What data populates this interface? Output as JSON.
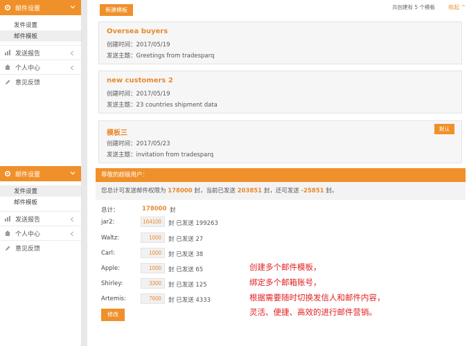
{
  "sidebar_top": {
    "header": "邮件设置",
    "sub_items": [
      "发件设置",
      "邮件模板"
    ],
    "active_index": 1,
    "items": [
      {
        "label": "发送报告",
        "icon": "chart-icon"
      },
      {
        "label": "个人中心",
        "icon": "home-icon"
      },
      {
        "label": "意见反馈",
        "icon": "pencil-icon"
      }
    ]
  },
  "sidebar_bottom": {
    "header": "邮件设置",
    "sub_items": [
      "发件设置",
      "邮件模板"
    ],
    "active_index": 0,
    "items": [
      {
        "label": "发送报告",
        "icon": "chart-icon"
      },
      {
        "label": "个人中心",
        "icon": "home-icon"
      },
      {
        "label": "意见反馈",
        "icon": "pencil-icon"
      }
    ]
  },
  "toolbar": {
    "new_template": "新建模板",
    "count_text": "共创建有 5 个模板",
    "collapse": "收起 ^"
  },
  "templates": [
    {
      "name": "Oversea buyers",
      "created": "创建时间：2017/05/19",
      "subject": "发送主题：Greetings from tradesparq",
      "default_btn": ""
    },
    {
      "name": "new customers 2",
      "created": "创建时间：2017/05/19",
      "subject": "发送主题：23 countries shipment data",
      "default_btn": ""
    },
    {
      "name": "模板三",
      "created": "创建时间：2017/05/23",
      "subject": "发送主题：invitation from tradesparq",
      "default_btn": "默认"
    }
  ],
  "quota": {
    "panel_title": "尊敬的超级用户：",
    "summary_prefix": "您总计可发送邮件权限为",
    "limit": "178000",
    "summary_mid1": "封，当前已发送",
    "sent": "203851",
    "summary_mid2": "封，还可发送",
    "remaining": "-25851",
    "summary_suffix": "封。",
    "total_label": "总计：",
    "total_value": "178000",
    "unit": "封",
    "accounts": [
      {
        "name": "jar2:",
        "quota": "164100",
        "sent_text": "封 已发送 199263"
      },
      {
        "name": "Waltz:",
        "quota": "1000",
        "sent_text": "封 已发送 27"
      },
      {
        "name": "Carl:",
        "quota": "1000",
        "sent_text": "封 已发送 38"
      },
      {
        "name": "Apple:",
        "quota": "1000",
        "sent_text": "封 已发送 65"
      },
      {
        "name": "Shirley:",
        "quota": "3300",
        "sent_text": "封 已发送 125"
      },
      {
        "name": "Artemis:",
        "quota": "7600",
        "sent_text": "封 已发送 4333"
      }
    ],
    "save_label": "修改"
  },
  "promo_lines": [
    "创建多个邮件模板，",
    "绑定多个邮箱账号，",
    "根据需要随时切换发信人和邮件内容，",
    "灵活、便捷、高效的进行邮件营销。"
  ],
  "colors": {
    "accent": "#f0902a",
    "promo": "#e02020"
  }
}
